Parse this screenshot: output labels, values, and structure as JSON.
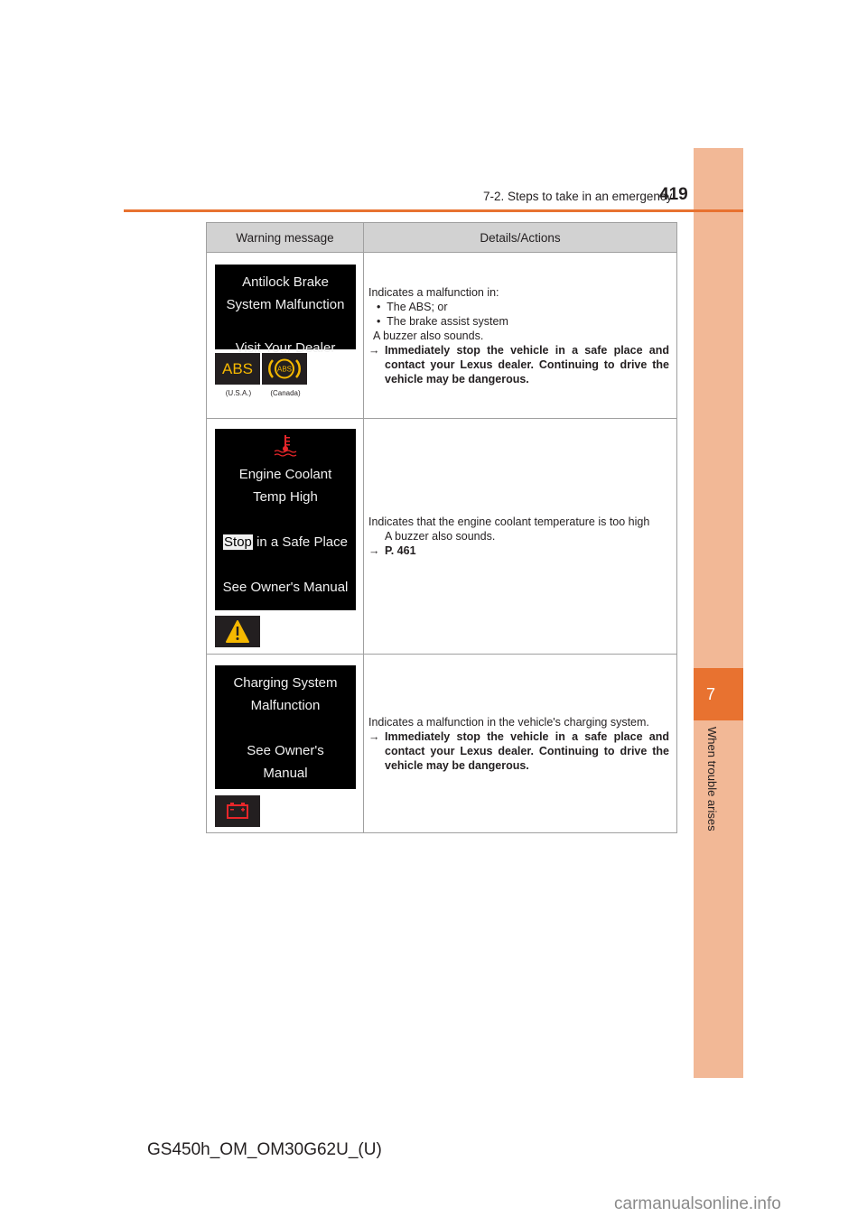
{
  "header": {
    "section_title": "7-2. Steps to take in an emergency",
    "page_number": "419"
  },
  "side_tab": {
    "chapter_number": "7",
    "chapter_title": "When trouble arises",
    "accent_color": "#e87230",
    "tab_color": "#f2b896"
  },
  "table": {
    "headers": [
      "Warning message",
      "Details/Actions"
    ],
    "rows": [
      {
        "screen_lines": [
          "Antilock Brake",
          "System Malfunction",
          "Visit Your Dealer"
        ],
        "icons": [
          {
            "name": "abs-text-icon",
            "label": "ABS",
            "caption": "(U.S.A.)",
            "color": "#f5b800"
          },
          {
            "name": "abs-circle-icon",
            "label": "ABS",
            "caption": "(Canada)",
            "color": "#f5b800"
          }
        ],
        "details": {
          "intro": "Indicates a malfunction in:",
          "bullets": [
            "The ABS; or",
            "The brake assist system"
          ],
          "note": "A buzzer also sounds.",
          "action": "Immediately stop the vehicle in a safe place and contact your Lexus dealer. Continuing to drive the vehicle may be dangerous."
        }
      },
      {
        "screen_lines": [
          "Engine Coolant",
          "Temp High",
          "Stop",
          "in a Safe Place",
          "See Owner's Manual"
        ],
        "icons": [
          {
            "name": "master-warning-icon",
            "color": "#f5b800"
          }
        ],
        "details": {
          "intro": "Indicates that the engine coolant temperature is too high",
          "note": "A buzzer also sounds.",
          "action": "P. 461"
        }
      },
      {
        "screen_lines": [
          "Charging System",
          "Malfunction",
          "See Owner's",
          "Manual"
        ],
        "icons": [
          {
            "name": "battery-icon",
            "color": "#e8262a"
          }
        ],
        "details": {
          "intro": "Indicates a malfunction in the vehicle's charging system.",
          "action": "Immediately stop the vehicle in a safe place and contact your Lexus dealer. Continuing to drive the vehicle may be dangerous."
        }
      }
    ]
  },
  "footer": {
    "model_code": "GS450h_OM_OM30G62U_(U)",
    "watermark": "carmanualsonline.info"
  },
  "symbols": {
    "arrow": "→",
    "bullet": "•"
  }
}
